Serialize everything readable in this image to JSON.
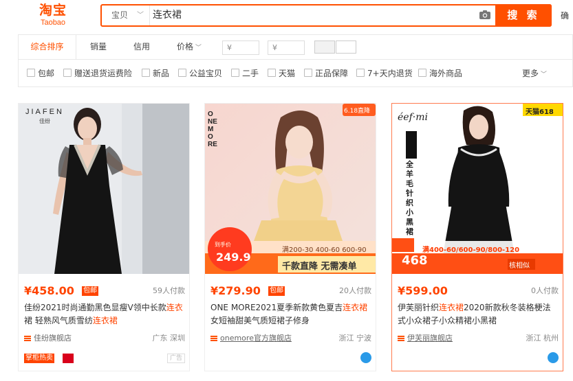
{
  "header": {
    "logo_cn": "淘宝",
    "logo_en": "Taobao",
    "scope_label": "宝贝",
    "search_query": "连衣裙",
    "search_button": "搜 索",
    "side_text": "确"
  },
  "sort_bar": {
    "items": [
      "综合排序",
      "销量",
      "信用",
      "价格"
    ],
    "price_min_placeholder": "¥",
    "price_max_placeholder": "¥",
    "dash": "-"
  },
  "filters": {
    "items": [
      "包邮",
      "赠送退货运费险",
      "新品",
      "公益宝贝",
      "二手",
      "天猫",
      "正品保障",
      "7+天内退货",
      "海外商品"
    ],
    "more": "更多"
  },
  "products": [
    {
      "price": "¥458.00",
      "baoyou": "包邮",
      "sales": "59人付款",
      "title_parts": [
        "佳纷2021时尚通勤黑色显瘦V领中长款",
        "连衣",
        "裙 轻熟风气质雪纺",
        "连衣裙"
      ],
      "shop": "佳纷旗舰店",
      "location": "广东 深圳",
      "tag": "掌柜热卖",
      "ad": "广告",
      "brand_logo": "JIAFEN",
      "brand_sub": "佳纷"
    },
    {
      "price": "¥279.90",
      "baoyou": "包邮",
      "sales": "20人付款",
      "title_parts": [
        "ONE MORE2021夏季新款黄色夏吉",
        "连衣裙",
        "女短袖甜美气质短裙子修身"
      ],
      "shop": "onemore官方旗舰店",
      "location": "浙江 宁波",
      "brand_logo": "ONE MORE",
      "corner_tag": "6.18直降",
      "promo_line": "满200-30 400-60 600-90",
      "promo_main": "千款直降 无需凑单",
      "promo_price": "249.9",
      "promo_price_label": "到手价"
    },
    {
      "price": "¥599.00",
      "baoyou": "",
      "sales": "0人付款",
      "title_parts": [
        "伊芙丽针织",
        "连衣裙",
        "2020新款秋冬装格梗法式小众裙子小众精裙小黑裙"
      ],
      "shop": "伊芙丽旗舰店",
      "location": "浙江 杭州",
      "brand_logo": "éef·mi",
      "corner_tag": "天猫618",
      "vertical_text": "全羊毛针织小黑裙",
      "promo_line": "满400-60/600-90/800-120",
      "promo_price": "468",
      "promo_tag": "核相似"
    }
  ],
  "colors": {
    "accent": "#ff5000",
    "price": "#ff4400",
    "brand_tmall_yellow": "#ffd800"
  }
}
